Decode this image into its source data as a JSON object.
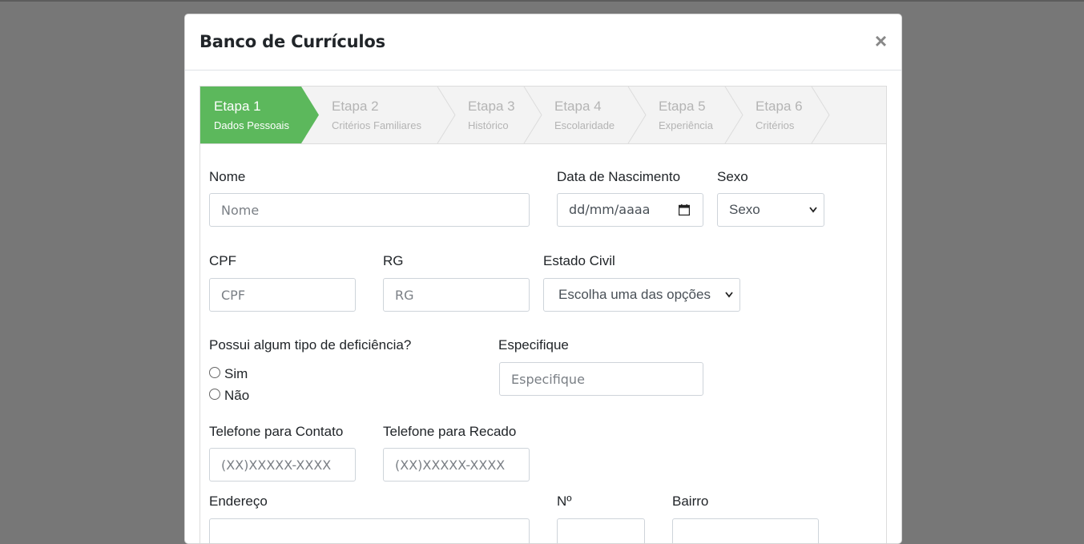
{
  "modal": {
    "title": "Banco de Currículos",
    "close_label": "×"
  },
  "wizard": {
    "steps": [
      {
        "title": "Etapa 1",
        "subtitle": "Dados Pessoais",
        "active": true
      },
      {
        "title": "Etapa 2",
        "subtitle": "Critérios Familiares",
        "active": false
      },
      {
        "title": "Etapa 3",
        "subtitle": "Histórico",
        "active": false
      },
      {
        "title": "Etapa 4",
        "subtitle": "Escolaridade",
        "active": false
      },
      {
        "title": "Etapa 5",
        "subtitle": "Experiência",
        "active": false
      },
      {
        "title": "Etapa 6",
        "subtitle": "Critérios",
        "active": false
      }
    ],
    "active_color": "#5cb85c",
    "inactive_color": "#f3f3f3"
  },
  "form": {
    "nome": {
      "label": "Nome",
      "placeholder": "Nome"
    },
    "nascimento": {
      "label": "Data de Nascimento",
      "value": "dd/mm/aaaa"
    },
    "sexo": {
      "label": "Sexo",
      "value": "Sexo"
    },
    "cpf": {
      "label": "CPF",
      "placeholder": "CPF"
    },
    "rg": {
      "label": "RG",
      "placeholder": "RG"
    },
    "estado_civil": {
      "label": "Estado Civil",
      "value": "Escolha uma das opções"
    },
    "deficiencia": {
      "label": "Possui algum tipo de deficiência?",
      "options": [
        "Sim",
        "Não"
      ]
    },
    "especifique": {
      "label": "Especifique",
      "placeholder": "Especifique"
    },
    "telefone_contato": {
      "label": "Telefone para Contato",
      "placeholder": "(XX)XXXXX-XXXX"
    },
    "telefone_recado": {
      "label": "Telefone para Recado",
      "placeholder": "(XX)XXXXX-XXXX"
    },
    "endereco": {
      "label": "Endereço"
    },
    "numero": {
      "label": "Nº"
    },
    "bairro": {
      "label": "Bairro"
    }
  }
}
